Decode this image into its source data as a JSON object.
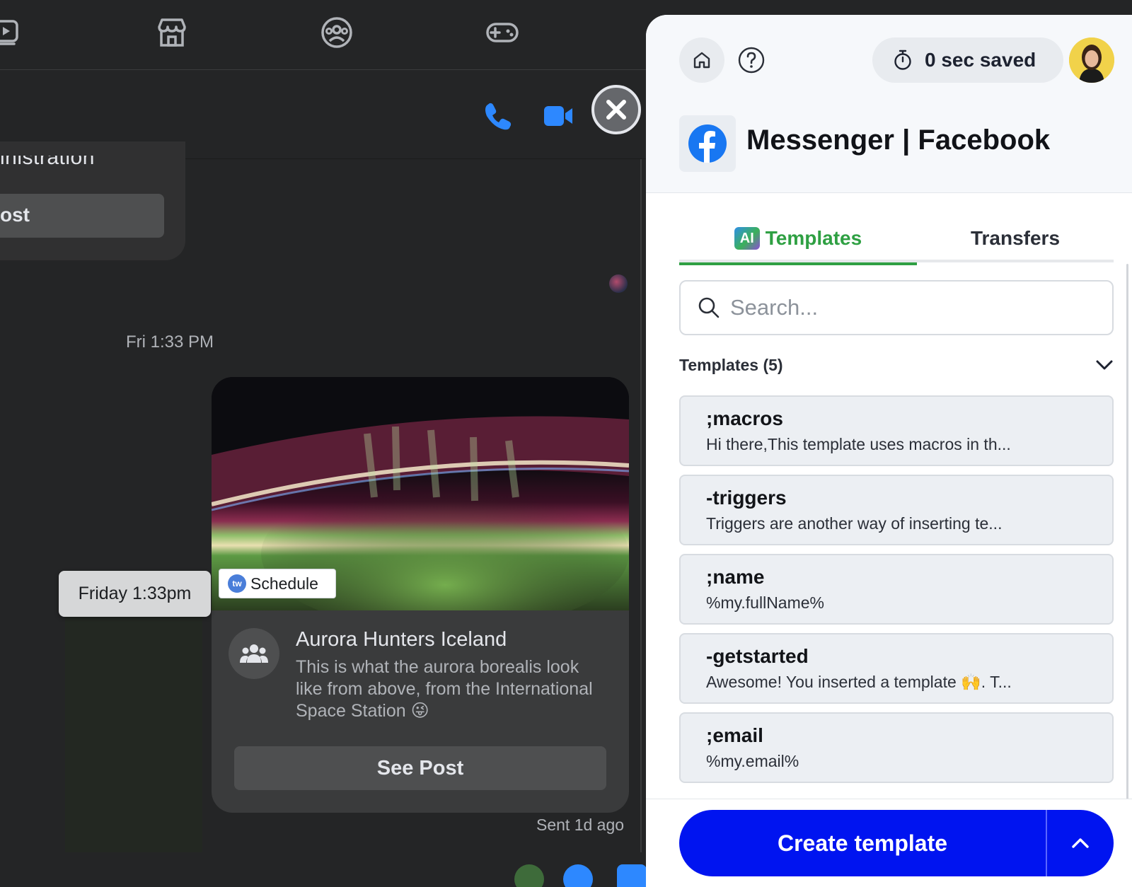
{
  "chat": {
    "previous_card_text": "inistration",
    "previous_card_button": "ost",
    "timestamp": "Fri 1:33 PM",
    "hover_tooltip": "Friday 1:33pm",
    "post": {
      "schedule_badge_icon": "tw",
      "schedule_badge": "Schedule",
      "group_name": "Aurora Hunters Iceland",
      "description": "This is what the aurora borealis look like from above, from the International Space Station 😜",
      "button": "See Post"
    },
    "sent_status": "Sent 1d ago"
  },
  "panel": {
    "time_saved": "0 sec saved",
    "app_title": "Messenger | Facebook",
    "tabs": [
      {
        "label": "Templates",
        "badge": "AI",
        "active": true
      },
      {
        "label": "Transfers",
        "active": false
      }
    ],
    "search": {
      "placeholder": "Search..."
    },
    "section": {
      "label": "Templates (5)"
    },
    "templates": [
      {
        "shortcut": ";macros",
        "preview": "Hi there,This template uses macros in th..."
      },
      {
        "shortcut": "-triggers",
        "preview": "Triggers are another way of inserting te..."
      },
      {
        "shortcut": ";name",
        "preview": "%my.fullName%"
      },
      {
        "shortcut": "-getstarted",
        "preview": "Awesome! You inserted a template 🙌. T..."
      },
      {
        "shortcut": ";email",
        "preview": "%my.email%"
      }
    ],
    "create_button": "Create template"
  },
  "colors": {
    "accent_green": "#2fa043",
    "create_blue": "#0014f0",
    "messenger_blue": "#2d88ff",
    "dark_bg": "#242526"
  }
}
